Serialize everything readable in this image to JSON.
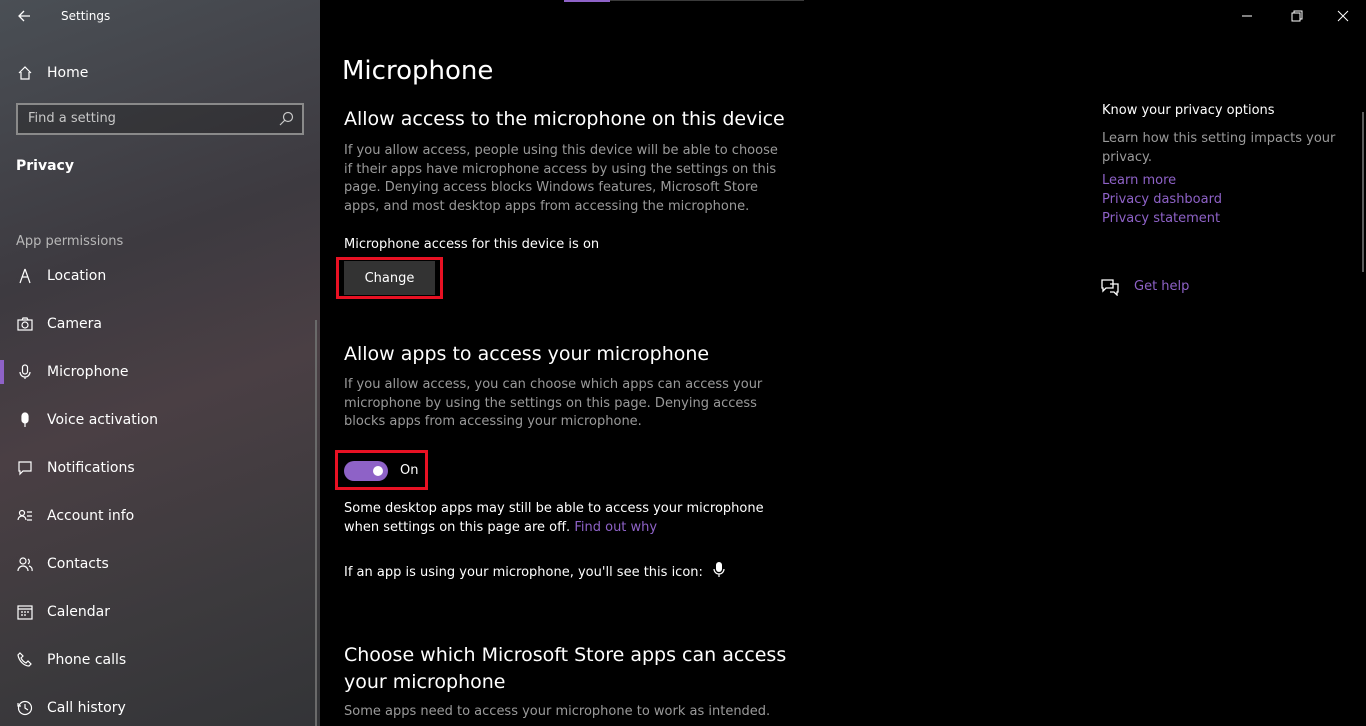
{
  "window": {
    "app_title": "Settings",
    "back_icon": "back-arrow-icon",
    "minimize_icon": "minimize-icon",
    "restore_icon": "restore-icon",
    "close_icon": "close-icon"
  },
  "sidebar": {
    "home_label": "Home",
    "search_placeholder": "Find a setting",
    "section_title": "Privacy",
    "group_label": "App permissions",
    "items": [
      {
        "label": "Location",
        "icon": "location-icon"
      },
      {
        "label": "Camera",
        "icon": "camera-icon"
      },
      {
        "label": "Microphone",
        "icon": "microphone-icon",
        "selected": true
      },
      {
        "label": "Voice activation",
        "icon": "voice-activation-icon"
      },
      {
        "label": "Notifications",
        "icon": "notifications-icon"
      },
      {
        "label": "Account info",
        "icon": "account-info-icon"
      },
      {
        "label": "Contacts",
        "icon": "contacts-icon"
      },
      {
        "label": "Calendar",
        "icon": "calendar-icon"
      },
      {
        "label": "Phone calls",
        "icon": "phone-calls-icon"
      },
      {
        "label": "Call history",
        "icon": "call-history-icon"
      }
    ],
    "accent_color": "#8e62c7"
  },
  "main": {
    "page_title": "Microphone",
    "device_section": {
      "heading": "Allow access to the microphone on this device",
      "description": "If you allow access, people using this device will be able to choose if their apps have microphone access by using the settings on this page. Denying access blocks Windows features, Microsoft Store apps, and most desktop apps from accessing the microphone.",
      "status": "Microphone access for this device is on",
      "change_button": "Change"
    },
    "apps_section": {
      "heading": "Allow apps to access your microphone",
      "description": "If you allow access, you can choose which apps can access your microphone by using the settings on this page. Denying access blocks apps from accessing your microphone.",
      "toggle_state": "On",
      "note": "Some desktop apps may still be able to access your microphone when settings on this page are off.",
      "note_link": "Find out why",
      "icon_note": "If an app is using your microphone, you'll see this icon:"
    },
    "store_section": {
      "heading_line1": "Choose which Microsoft Store apps can access",
      "heading_line2": "your microphone",
      "description_partial": "Some apps need to access your microphone to work as intended."
    }
  },
  "rail": {
    "title": "Know your privacy options",
    "description": "Learn how this setting impacts your privacy.",
    "links": [
      "Learn more",
      "Privacy dashboard",
      "Privacy statement"
    ],
    "help_label": "Get help",
    "highlight_color": "#e81123"
  }
}
